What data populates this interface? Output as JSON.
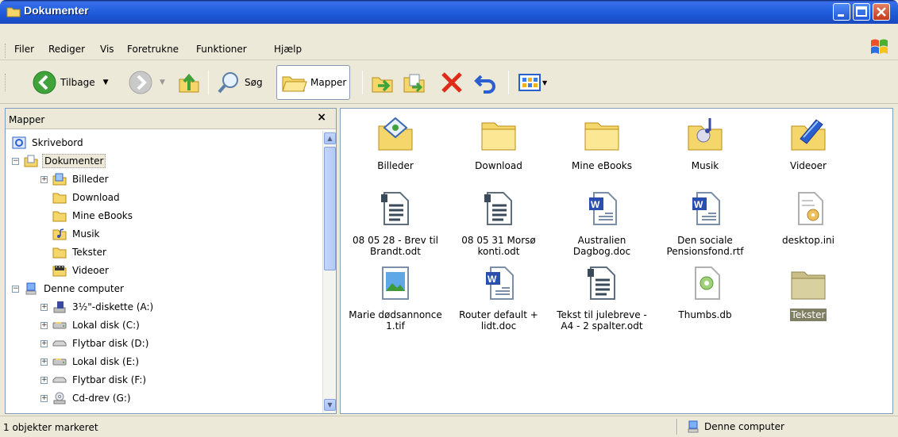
{
  "window": {
    "title": "Dokumenter"
  },
  "menu": [
    "Filer",
    "Rediger",
    "Vis",
    "Foretrukne",
    "Funktioner",
    "Hjælp"
  ],
  "toolbar": {
    "back": "Tilbage",
    "search": "Søg",
    "folders": "Mapper"
  },
  "left_pane": {
    "title": "Mapper",
    "close": "×",
    "tree": [
      {
        "label": "Skrivebord",
        "icon": "desktop-icon"
      },
      {
        "label": "Dokumenter",
        "icon": "documents-folder-icon"
      },
      {
        "label": "Billeder",
        "icon": "pictures-folder-icon"
      },
      {
        "label": "Download",
        "icon": "folder-icon"
      },
      {
        "label": "Mine eBooks",
        "icon": "folder-icon"
      },
      {
        "label": "Musik",
        "icon": "music-folder-icon"
      },
      {
        "label": "Tekster",
        "icon": "folder-icon"
      },
      {
        "label": "Videoer",
        "icon": "video-folder-icon"
      },
      {
        "label": "Denne computer",
        "icon": "computer-icon"
      },
      {
        "label": "3½\"-diskette (A:)",
        "icon": "floppy-icon"
      },
      {
        "label": "Lokal disk (C:)",
        "icon": "hard-disk-icon"
      },
      {
        "label": "Flytbar disk (D:)",
        "icon": "removable-disk-icon"
      },
      {
        "label": "Lokal disk (E:)",
        "icon": "hard-disk-icon"
      },
      {
        "label": "Flytbar disk (F:)",
        "icon": "removable-disk-icon"
      },
      {
        "label": "Cd-drev (G:)",
        "icon": "cd-drive-icon"
      }
    ]
  },
  "items": [
    {
      "name": "Billeder",
      "icon": "pictures-folder-icon"
    },
    {
      "name": "Download",
      "icon": "folder-icon"
    },
    {
      "name": "Mine eBooks",
      "icon": "folder-icon"
    },
    {
      "name": "Musik",
      "icon": "music-folder-icon"
    },
    {
      "name": "Videoer",
      "icon": "video-folder-icon"
    },
    {
      "name": "08 05 28 - Brev til Brandt.odt",
      "icon": "odt-document-icon"
    },
    {
      "name": "08 05 31 Morsø konti.odt",
      "icon": "odt-document-icon"
    },
    {
      "name": "Australien Dagbog.doc",
      "icon": "word-document-icon"
    },
    {
      "name": "Den sociale Pensionsfond.rtf",
      "icon": "word-document-icon"
    },
    {
      "name": "desktop.ini",
      "icon": "settings-file-icon"
    },
    {
      "name": "Marie dødsannonce 1.tif",
      "icon": "image-file-icon"
    },
    {
      "name": "Router default + lidt.doc",
      "icon": "word-document-icon"
    },
    {
      "name": "Tekst til julebreve - A4 - 2 spalter.odt",
      "icon": "odt-document-icon"
    },
    {
      "name": "Thumbs.db",
      "icon": "db-file-icon"
    },
    {
      "name": "Tekster",
      "icon": "folder-icon"
    }
  ],
  "status": {
    "left": "1 objekter markeret",
    "right": "Denne computer"
  }
}
